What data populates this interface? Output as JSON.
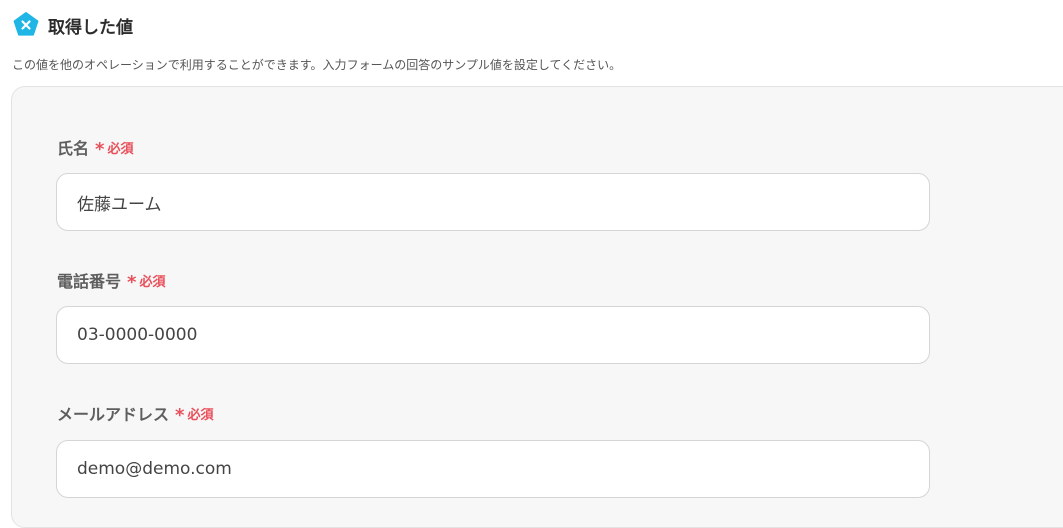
{
  "header": {
    "title": "取得した値",
    "icon": "yoom-x-icon",
    "icon_color": "#1fb6e6"
  },
  "description": "この値を他のオペレーションで利用することができます。入力フォームの回答のサンプル値を設定してください。",
  "fields": [
    {
      "label": "氏名",
      "required_mark": "*",
      "required_text": "必須",
      "value": "佐藤ユーム"
    },
    {
      "label": "電話番号",
      "required_mark": "*",
      "required_text": "必須",
      "value": "03-0000-0000"
    },
    {
      "label": "メールアドレス",
      "required_mark": "*",
      "required_text": "必須",
      "value": "demo@demo.com"
    }
  ],
  "colors": {
    "required": "#e8505b",
    "panel_bg": "#f7f7f7"
  }
}
